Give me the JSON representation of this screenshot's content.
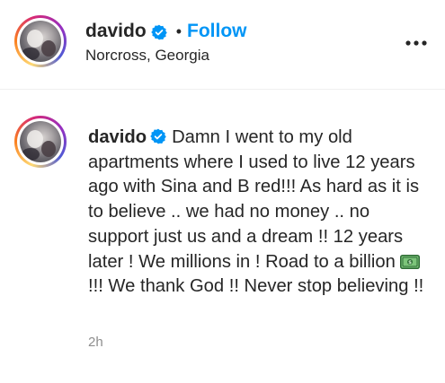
{
  "post": {
    "header": {
      "username": "davido",
      "follow_label": "Follow",
      "separator": "•",
      "location": "Norcross, Georgia",
      "more_icon": "more-options-icon"
    },
    "caption": {
      "username": "davido",
      "text_part1": "Damn I went to my old apartments where I used to live 12 years ago with Sina and B red!!! As hard as it is to believe .. we had no money .. no support just us and a dream !! 12 years later ! We millions in ! Road to a billion ",
      "emoji_icon": "dollar-bill-emoji",
      "text_part2": "!!! We thank God !! Never stop believing !!"
    },
    "timestamp": "2h"
  },
  "colors": {
    "link": "#0095f6",
    "text": "#262626",
    "muted": "#8e8e8e",
    "verified": "#0095f6",
    "divider": "#efefef"
  }
}
